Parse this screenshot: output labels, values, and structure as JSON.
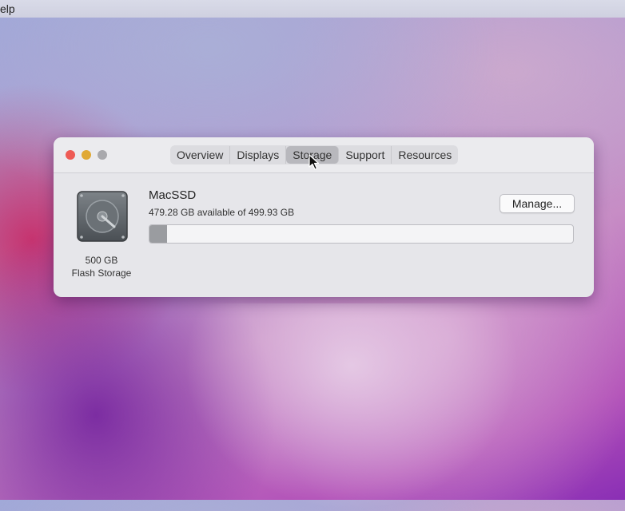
{
  "menubar": {
    "fragment": "elp"
  },
  "window": {
    "tabs": [
      {
        "label": "Overview"
      },
      {
        "label": "Displays"
      },
      {
        "label": "Storage"
      },
      {
        "label": "Support"
      },
      {
        "label": "Resources"
      }
    ],
    "active_tab": "Storage"
  },
  "storage": {
    "volume_name": "MacSSD",
    "availability": "479.28 GB available of 499.93 GB",
    "used_fraction": 0.041,
    "drive_capacity": "500 GB",
    "drive_type": "Flash Storage",
    "drive_icon": "hard-drive-icon",
    "manage_label": "Manage..."
  }
}
